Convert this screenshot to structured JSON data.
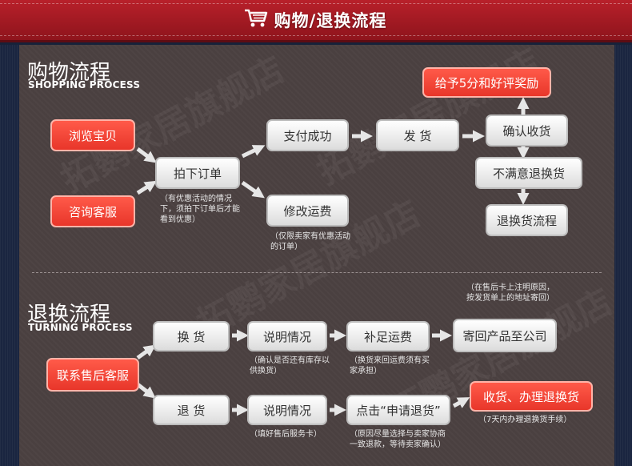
{
  "banner": {
    "title": "购物/退换流程"
  },
  "watermark": "拓鹦家居旗舰店",
  "shopping": {
    "heading_cn": "购物流程",
    "heading_en": "SHOPPING PROCESS",
    "nodes": {
      "browse": "浏览宝贝",
      "consult": "咨询客服",
      "order": "拍下订单",
      "pay": "支付成功",
      "ship": "发 货",
      "confirm": "确认收货",
      "reward": "给予5分和好评奖励",
      "unsatisfied": "不满意退换货",
      "return_flow": "退换货流程",
      "modify_shipping": "修改运费"
    },
    "notes": {
      "order_note": "（有优惠活动的情况下，须拍下订单后才能看到优惠）",
      "shipping_note": "（仅限卖家有优惠活动的订单）"
    }
  },
  "returns": {
    "heading_cn": "退换流程",
    "heading_en": "TURNING PROCESS",
    "nodes": {
      "contact": "联系售后客服",
      "exchange": "换 货",
      "explain1": "说明情况",
      "pay_shipping": "补足运费",
      "send_back": "寄回产品至公司",
      "refund": "退 货",
      "explain2": "说明情况",
      "apply": "点击“申请退货”",
      "receive": "收货、办理退换货"
    },
    "notes": {
      "sendback_note": "（在售后卡上注明原因，按发货单上的地址寄回）",
      "explain1_note": "（确认是否还有库存以供换货）",
      "payship_note": "（换货来回运费须有买家承担）",
      "explain2_note": "（填好售后服务卡）",
      "apply_note": "（原因尽量选择与卖家协商一致退款，等待卖家确认）",
      "receive_note": "（7天内办理退换货手续）"
    }
  },
  "colors": {
    "banner": "#a51a24",
    "accent": "#e8362a",
    "bg": "#4a4040",
    "border": "#17223a"
  },
  "icons": {
    "cart": "shopping-cart-icon"
  }
}
